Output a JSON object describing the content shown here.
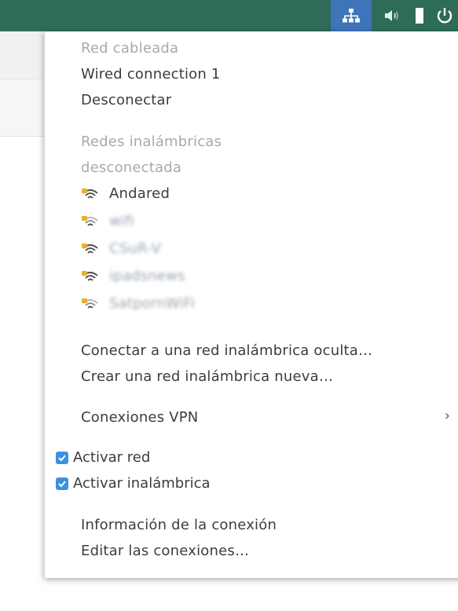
{
  "panel": {
    "indicators": [
      "network-icon",
      "sound-icon",
      "battery-icon",
      "power-icon"
    ],
    "accent": "#3e74b8",
    "background": "#2e6b58"
  },
  "menu": {
    "wired_header": "Red cableada",
    "wired_connection": "Wired connection 1",
    "disconnect": "Desconectar",
    "wireless_header": "Redes inalámbricas",
    "wireless_status": "desconectada",
    "networks": [
      {
        "name": "Andared",
        "blurred": false
      },
      {
        "name": "wifi",
        "blurred": true
      },
      {
        "name": "CSuR-V",
        "blurred": true
      },
      {
        "name": "ipadsnews",
        "blurred": true
      },
      {
        "name": "SatpornWiFi",
        "blurred": true
      }
    ],
    "connect_hidden": "Conectar a una red inalámbrica oculta…",
    "create_new": "Crear una red inalámbrica nueva…",
    "vpn": "Conexiones VPN",
    "vpn_arrow": "›",
    "enable_network": "Activar red",
    "enable_wireless": "Activar inalámbrica",
    "connection_info": "Información de la conexión",
    "edit_connections": "Editar las conexiones…"
  }
}
